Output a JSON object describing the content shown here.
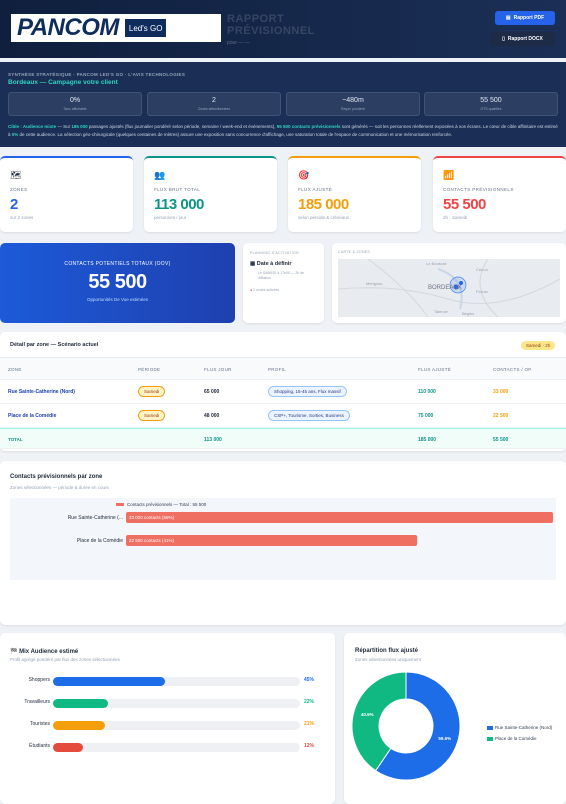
{
  "header": {
    "logo_name": "PANCOM",
    "logo_tag": "Led's GO",
    "report_title_line1": "RAPPORT",
    "report_title_line2": "PRÉVISIONNEL",
    "report_subtitle": "pour — —",
    "pdf_label": "Rapport PDF",
    "docx_label": "Rapport DOCX"
  },
  "synthesis": {
    "eyebrow": "SYNTHÈSE STRATÉGIQUE · PANCOM LED'S GO · L'AVIS TECHNOLOGIES",
    "campaign": "Bordeaux — Campagne votre client",
    "kpis": [
      {
        "value": "0%",
        "label": "Taux affichable"
      },
      {
        "value": "2",
        "label": "Zones sélectionnées"
      },
      {
        "value": "~480m",
        "label": "Rayon pondéré"
      },
      {
        "value": "55 500",
        "label": "OTS qualifiés"
      }
    ],
    "desc_a": "Cible : Audience mixte",
    "desc_b": " — Sur ",
    "desc_c": "185 000",
    "desc_d": " passages ajustés (flux journalier pondéré selon période, semaine / week-end et événements), ",
    "desc_e": "55 500 contacts prévisionnels",
    "desc_f": " sont générés — soit les personnes réellement exposées à vos écrans. Le cœur de cible affinitaire est estimé à ",
    "desc_g": "0%",
    "desc_h": " de cette audience. La sélection géo-chirurgicale (quelques centaines de mètres) assure une exposition sans concurrence d'affichage, une saturation totale de l'espace de communication et une mémorisation renforcée."
  },
  "stats": [
    {
      "icon": "world-map-icon",
      "glyph": "🗺",
      "label": "ZONES",
      "value": "2",
      "sub": "sur 2 zones",
      "color": "#2563eb"
    },
    {
      "icon": "people-icon",
      "glyph": "👥",
      "label": "FLUX BRUT TOTAL",
      "value": "113 000",
      "sub": "personnes / jour",
      "color": "#0d9488"
    },
    {
      "icon": "target-icon",
      "glyph": "🎯",
      "label": "FLUX AJUSTÉ",
      "value": "185 000",
      "sub": "selon période & créneaux",
      "color": "#f59e0b"
    },
    {
      "icon": "chart-icon",
      "glyph": "📶",
      "label": "CONTACTS PRÉVISIONNELS",
      "value": "55 500",
      "sub": "2h · Samedi",
      "color": "#ef4444"
    }
  ],
  "highlight": {
    "label": "CONTACTS POTENTIELS TOTAUX (OOV)",
    "value": "55 500",
    "sub": "Opportunités De Vue estimées"
  },
  "planning": {
    "title": "PLANNING D'ACTIVATION",
    "date": "Date à définir",
    "slot": "Le SAMEDI à 17h00 — 2h de diffusion",
    "zones": "2 zones activées"
  },
  "map": {
    "title": "CARTE & ZONES",
    "city": "BORDEAUX",
    "places": [
      "Le Bouscat",
      "Cenon",
      "Mérignac",
      "Floirac",
      "Talence",
      "Bègles"
    ]
  },
  "table": {
    "title": "Détail par zone — Scénario actuel",
    "badge": "Samedi · 2h",
    "headers": [
      "ZONE",
      "PÉRIODE",
      "FLUX JOUR",
      "PROFIL",
      "FLUX AJUSTÉ",
      "CONTACTS / OP."
    ],
    "rows": [
      {
        "zone": "Rue Sainte-Catherine (Nord)",
        "period": "Samedi",
        "flux": "65 000",
        "profile": "Shopping, 15-45 ans, Flux massif",
        "adjusted": "110 000",
        "contacts": "33 000"
      },
      {
        "zone": "Place de la Comédie",
        "period": "Samedi",
        "flux": "48 000",
        "profile": "CSP+, Tourisme, Sorties, Business",
        "adjusted": "75 000",
        "contacts": "22 500"
      }
    ],
    "total": {
      "label": "TOTAL",
      "flux": "113 000",
      "adjusted": "185 000",
      "contacts": "55 500"
    }
  },
  "zone_chart": {
    "title": "Contacts prévisionnels par zone",
    "subtitle": "Zones sélectionnées — période & durée en cours",
    "legend": "Contacts prévisionnels — Total : 55 500",
    "chart_data": {
      "type": "bar",
      "orientation": "horizontal",
      "categories": [
        "Rue Sainte-Catherine (...",
        "Place de la Comédie"
      ],
      "values": [
        33000,
        22500
      ],
      "data_labels": [
        "33 000 contacts (59%)",
        "22 500 contacts (41%)"
      ],
      "color": "#ef6f62"
    }
  },
  "mix": {
    "title": "Mix Audience estimé",
    "subtitle": "Profil agrégé pondéré par flux des zones sélectionnées",
    "chart_data": {
      "type": "bar",
      "orientation": "horizontal",
      "categories": [
        "Shoppers",
        "Travailleurs",
        "Touristes",
        "Étudiants"
      ],
      "values": [
        45,
        22,
        21,
        12
      ],
      "unit": "%",
      "colors": [
        "#1d6ce8",
        "#10b981",
        "#f59e0b",
        "#e54b3c"
      ]
    }
  },
  "repartition": {
    "title": "Répartition flux ajusté",
    "subtitle": "Zones sélectionnées uniquement",
    "chart_data": {
      "type": "pie",
      "style": "donut",
      "labels": [
        "Rue Sainte-Catherine (Nord)",
        "Place de la Comédie"
      ],
      "values": [
        59.5,
        40.5
      ],
      "colors": [
        "#1d6ce8",
        "#10b981"
      ]
    },
    "slice_labels": [
      "59.5%",
      "40.5%"
    ]
  }
}
